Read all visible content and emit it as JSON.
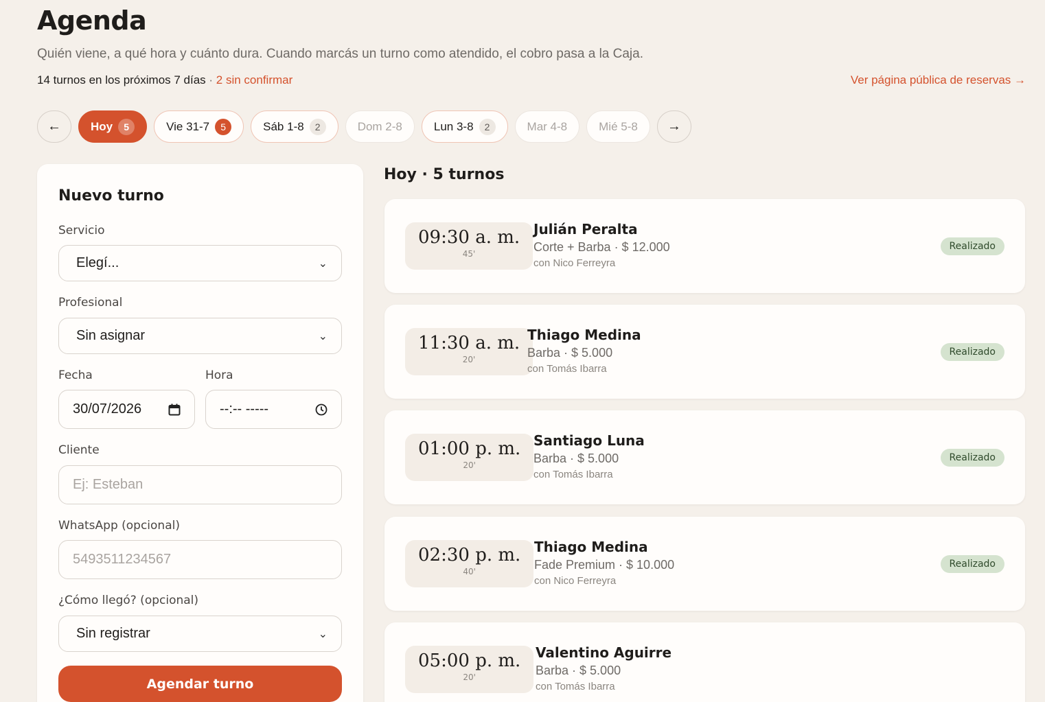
{
  "header": {
    "title": "Agenda",
    "subtitle": "Quién viene, a qué hora y cuánto dura. Cuando marcás un turno como atendido, el cobro pasa a la Caja.",
    "summary": "14 turnos en los próximos 7 días",
    "separator": " · ",
    "unconfirmed": "2 sin confirmar",
    "public_link": "Ver página pública de reservas →"
  },
  "day_nav": {
    "prev": "←",
    "next": "→",
    "days": [
      {
        "label": "Hoy",
        "count": "5"
      },
      {
        "label": "Vie 31-7",
        "count": "5"
      },
      {
        "label": "Sáb 1-8",
        "count": "2"
      },
      {
        "label": "Dom 2-8",
        "count": ""
      },
      {
        "label": "Lun 3-8",
        "count": "2"
      },
      {
        "label": "Mar 4-8",
        "count": ""
      },
      {
        "label": "Mié 5-8",
        "count": ""
      }
    ]
  },
  "form": {
    "title": "Nuevo turno",
    "servicio_label": "Servicio",
    "servicio_value": "Elegí...",
    "profesional_label": "Profesional",
    "profesional_value": "Sin asignar",
    "fecha_label": "Fecha",
    "fecha_value": "30/07/2026",
    "hora_label": "Hora",
    "hora_value": "--:-- -----",
    "cliente_label": "Cliente",
    "cliente_placeholder": "Ej: Esteban",
    "whatsapp_label": "WhatsApp (opcional)",
    "whatsapp_placeholder": "5493511234567",
    "origen_label": "¿Cómo llegó? (opcional)",
    "origen_value": "Sin registrar",
    "submit_label": "Agendar turno"
  },
  "list": {
    "title": "Hoy · 5 turnos",
    "appointments": [
      {
        "time": "09:30 a. m.",
        "duration": "45'",
        "client": "Julián Peralta",
        "service": "Corte + Barba · $ 12.000",
        "staff": "con Nico Ferreyra",
        "status": "Realizado"
      },
      {
        "time": "11:30 a. m.",
        "duration": "20'",
        "client": "Thiago Medina",
        "service": "Barba · $ 5.000",
        "staff": "con Tomás Ibarra",
        "status": "Realizado"
      },
      {
        "time": "01:00 p. m.",
        "duration": "20'",
        "client": "Santiago Luna",
        "service": "Barba · $ 5.000",
        "staff": "con Tomás Ibarra",
        "status": "Realizado"
      },
      {
        "time": "02:30 p. m.",
        "duration": "40'",
        "client": "Thiago Medina",
        "service": "Fade Premium · $ 10.000",
        "staff": "con Nico Ferreyra",
        "status": "Realizado"
      },
      {
        "time": "05:00 p. m.",
        "duration": "20'",
        "client": "Valentino Aguirre",
        "service": "Barba · $ 5.000",
        "staff": "con Tomás Ibarra",
        "status": ""
      }
    ]
  },
  "colors": {
    "accent": "#d4522d",
    "background": "#f5f0ea",
    "status_done_bg": "#d5e3cf"
  }
}
